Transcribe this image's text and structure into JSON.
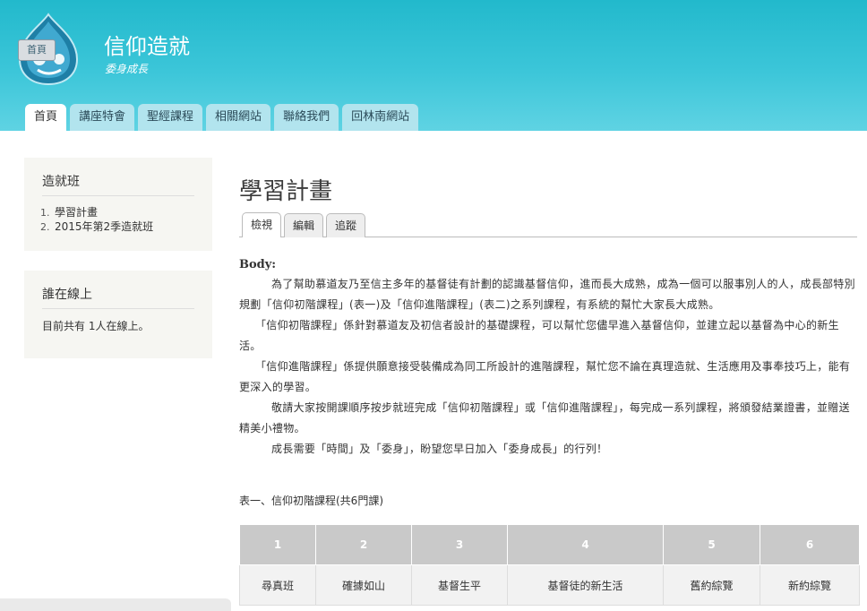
{
  "header": {
    "logo_badge": "首頁",
    "site_name": "信仰造就",
    "site_slogan": "委身成長"
  },
  "nav": {
    "tabs": [
      {
        "label": "首頁",
        "active": true
      },
      {
        "label": "講座特會",
        "active": false
      },
      {
        "label": "聖經課程",
        "active": false
      },
      {
        "label": "相關網站",
        "active": false
      },
      {
        "label": "聯絡我們",
        "active": false
      },
      {
        "label": "回林南網站",
        "active": false
      }
    ]
  },
  "sidebar": {
    "block1": {
      "title": "造就班",
      "items": [
        "學習計畫",
        "2015年第2季造就班"
      ]
    },
    "block2": {
      "title": "誰在線上",
      "text": "目前共有 1人在線上。"
    }
  },
  "main": {
    "title": "學習計畫",
    "local_tabs": [
      {
        "label": "檢視",
        "active": true
      },
      {
        "label": "編輯",
        "active": false
      },
      {
        "label": "追蹤",
        "active": false
      }
    ],
    "body_label": "Body:",
    "paragraphs": [
      "為了幫助慕道友乃至信主多年的基督徒有計劃的認識基督信仰，進而長大成熟，成為一個可以服事別人的人，成長部特別規劃「信仰初階課程」(表一)及「信仰進階課程」(表二)之系列課程，有系統的幫忙大家長大成熟。",
      "「信仰初階課程」係針對慕道友及初信者設計的基礎課程，可以幫忙您儘早進入基督信仰，並建立起以基督為中心的新生活。",
      "「信仰進階課程」係提供願意接受裝備成為同工所設計的進階課程，幫忙您不論在真理造就、生活應用及事奉技巧上，能有更深入的學習。",
      "敬請大家按開課順序按步就班完成「信仰初階課程」或「信仰進階課程」，每完成一系列課程，將頒發結業證書，並贈送精美小禮物。",
      "成長需要「時間」及「委身」，盼望您早日加入「委身成長」的行列！"
    ],
    "table_caption": "表一、信仰初階課程(共6門課)",
    "table": {
      "headers": [
        "1",
        "2",
        "3",
        "4",
        "5",
        "6"
      ],
      "cells": [
        "尋真班",
        "確據如山",
        "基督生平",
        "基督徒的新生活",
        "舊約綜覽",
        "新約綜覽"
      ]
    }
  },
  "colors": {
    "header_top": "#22b9cc",
    "header_bottom": "#5fd3e3",
    "tab_bg": "#b2e4ee",
    "sidebar_bg": "#f6f6f2",
    "table_header_bg": "#c9c9c9"
  }
}
